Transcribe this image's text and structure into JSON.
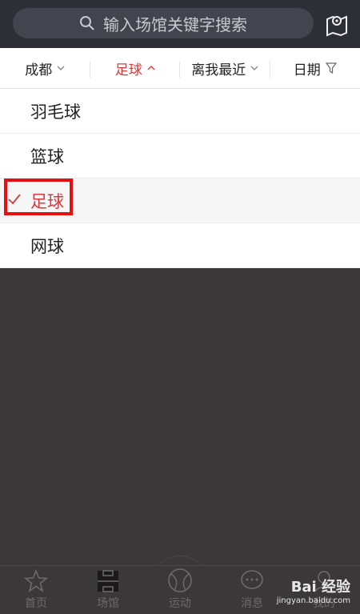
{
  "search": {
    "placeholder": "输入场馆关键字搜索"
  },
  "filters": [
    {
      "label": "成都"
    },
    {
      "label": "足球"
    },
    {
      "label": "离我最近"
    },
    {
      "label": "日期"
    }
  ],
  "sports": [
    {
      "label": "羽毛球"
    },
    {
      "label": "篮球"
    },
    {
      "label": "足球"
    },
    {
      "label": "网球"
    }
  ],
  "tabs": [
    {
      "label": "首页"
    },
    {
      "label": "场馆"
    },
    {
      "label": "运动"
    },
    {
      "label": "消息"
    },
    {
      "label": "我的"
    }
  ],
  "watermark": {
    "brand": "Bai 经验",
    "url": "jingyan.baidu.com"
  },
  "colors": {
    "accent": "#d8393c",
    "highlight_box": "#e50f0f",
    "header_bg": "#2e2e37",
    "overlay": "#3a3839"
  },
  "selected_sport": "足球"
}
